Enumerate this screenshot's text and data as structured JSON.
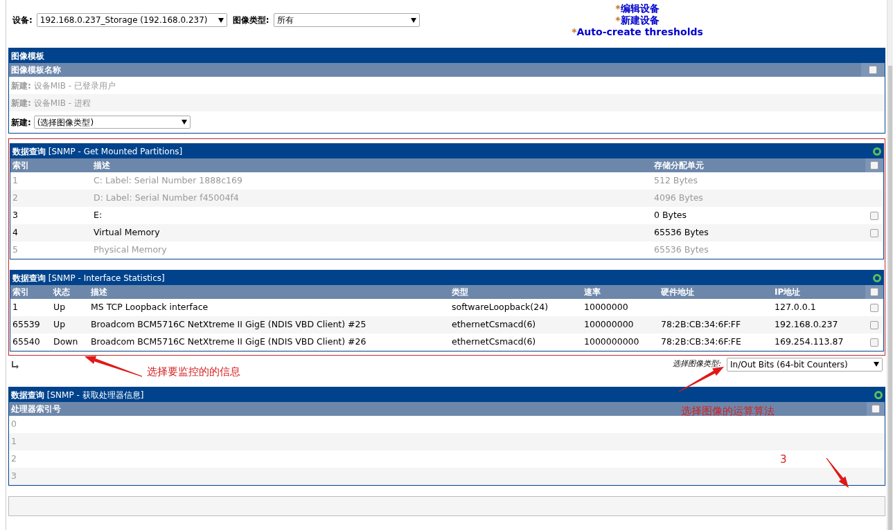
{
  "device_bar": {
    "device_label": "设备:",
    "device_value": "192.168.0.237_Storage (192.168.0.237)",
    "graph_type_label": "图像类型:",
    "graph_type_value": "所有"
  },
  "links": [
    {
      "marker": "*",
      "text": "编辑设备"
    },
    {
      "marker": "*",
      "text": "新建设备"
    },
    {
      "marker": "*",
      "text": "Auto-create thresholds"
    }
  ],
  "graph_templates": {
    "title": "图像模板",
    "column": "图像模板名称",
    "header_checked": false,
    "rows": [
      {
        "kind": "text",
        "label": "新建:",
        "name": "设备MIB - 已登录用户"
      },
      {
        "kind": "text",
        "label": "新建:",
        "name": "设备MIB - 进程"
      },
      {
        "kind": "select",
        "label": "新建:",
        "value": "(选择图像类型)"
      }
    ]
  },
  "data_queries": [
    {
      "title_prefix": "数据查询",
      "title": "[SNMP - Get Mounted Partitions]",
      "columns": [
        "索引",
        "描述",
        "存储分配单元"
      ],
      "header_checked": false,
      "rows": [
        {
          "cells": [
            "1",
            "C: Label: Serial Number 1888c169",
            "512 Bytes"
          ],
          "disabled": true
        },
        {
          "cells": [
            "2",
            "D: Label: Serial Number f45004f4",
            "4096 Bytes"
          ],
          "disabled": true
        },
        {
          "cells": [
            "3",
            "E:",
            "0 Bytes"
          ],
          "disabled": false,
          "checked": false
        },
        {
          "cells": [
            "4",
            "Virtual Memory",
            "65536 Bytes"
          ],
          "disabled": false,
          "checked": false
        },
        {
          "cells": [
            "5",
            "Physical Memory",
            "65536 Bytes"
          ],
          "disabled": true
        }
      ]
    },
    {
      "title_prefix": "数据查询",
      "title": "[SNMP - Interface Statistics]",
      "columns": [
        "索引",
        "状态",
        "描述",
        "类型",
        "速率",
        "硬件地址",
        "IP地址"
      ],
      "header_checked": false,
      "rows": [
        {
          "cells": [
            "1",
            "Up",
            "MS TCP Loopback interface",
            "softwareLoopback(24)",
            "10000000",
            "",
            "127.0.0.1"
          ],
          "disabled": false,
          "checked": false
        },
        {
          "cells": [
            "65539",
            "Up",
            "Broadcom BCM5716C NetXtreme II GigE (NDIS VBD Client) #25",
            "ethernetCsmacd(6)",
            "100000000",
            "78:2B:CB:34:6F:FF",
            "192.168.0.237"
          ],
          "disabled": false,
          "checked": false
        },
        {
          "cells": [
            "65540",
            "Down",
            "Broadcom BCM5716C NetXtreme II GigE (NDIS VBD Client) #26",
            "ethernetCsmacd(6)",
            "1000000000",
            "78:2B:CB:34:6F:FE",
            "169.254.113.87"
          ],
          "disabled": false,
          "checked": false
        }
      ],
      "graph_select": {
        "label": "选择图像类型:",
        "value": "In/Out Bits (64-bit Counters)"
      }
    },
    {
      "title_prefix": "数据查询",
      "title": "[SNMP - 获取处理器信息]",
      "columns": [
        "处理器索引号"
      ],
      "header_checked": false,
      "rows": [
        {
          "cells": [
            "0"
          ],
          "disabled": true
        },
        {
          "cells": [
            "1"
          ],
          "disabled": true
        },
        {
          "cells": [
            "2"
          ],
          "disabled": true
        },
        {
          "cells": [
            "3"
          ],
          "disabled": true
        }
      ]
    }
  ],
  "annotations": [
    "选择要监控的的信息",
    "选择图像的运算算法",
    "3"
  ]
}
